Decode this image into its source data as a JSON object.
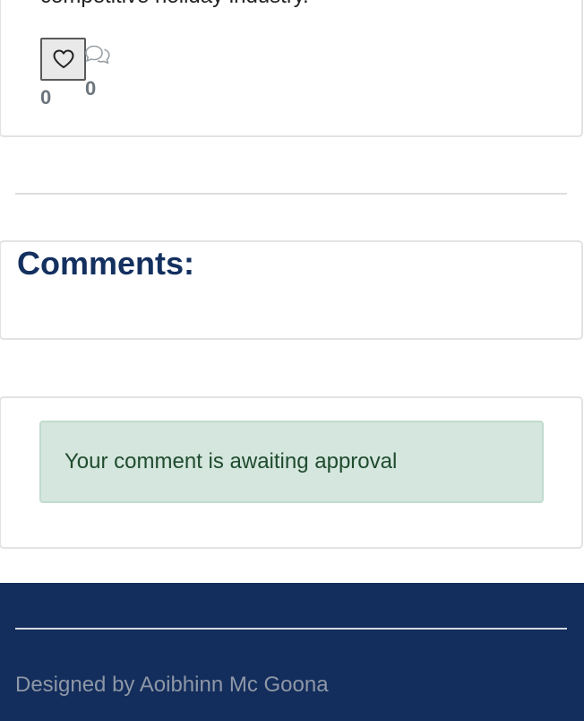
{
  "post": {
    "text_fragment": "competitive holiday industry.",
    "like_count": "0",
    "comment_count": "0"
  },
  "comments": {
    "heading": "Comments:"
  },
  "approval": {
    "message": "Your comment is awaiting approval"
  },
  "footer": {
    "credit": "Designed by Aoibhinn Mc Goona"
  },
  "icons": {
    "like": "heart-icon",
    "comments": "speech-bubbles-icon"
  },
  "colors": {
    "heading": "#13305f",
    "footer_bg": "#132d5c",
    "alert_bg": "#d4e6dd",
    "alert_text": "#1f4b2e",
    "count_text": "#6c757d"
  }
}
